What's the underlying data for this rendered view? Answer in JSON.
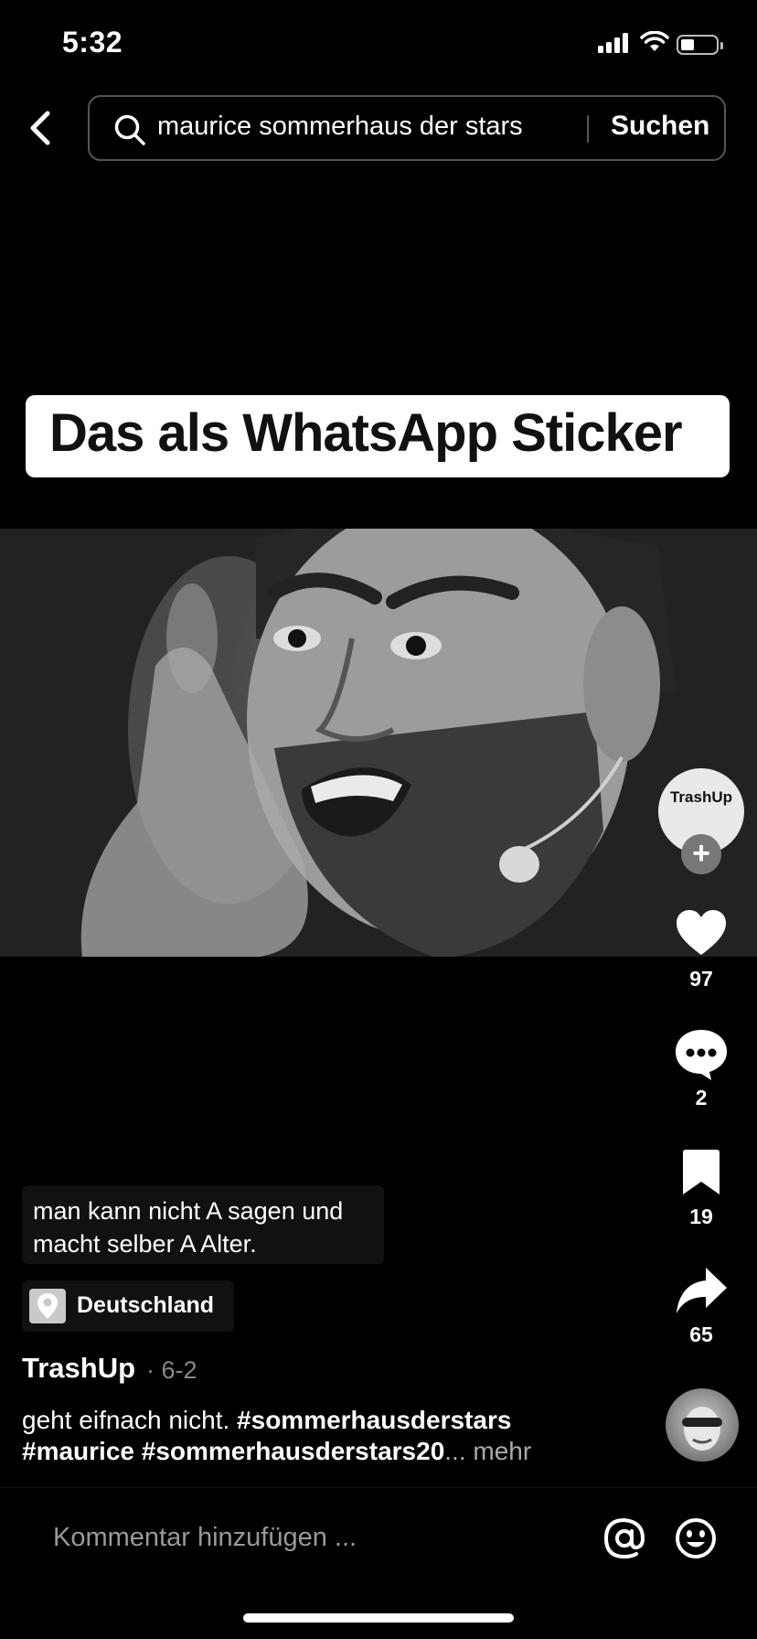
{
  "status_bar": {
    "time": "5:32"
  },
  "search": {
    "query": "maurice sommerhaus der stars",
    "button_label": "Suchen"
  },
  "video": {
    "overlay_text": "Das als WhatsApp Sticker"
  },
  "rail": {
    "avatar_label": "TrashUp",
    "likes": "97",
    "comments": "2",
    "saves": "19",
    "shares": "65"
  },
  "post": {
    "subtitle_text": "man kann nicht A sagen und macht selber A Alter.",
    "location": "Deutschland",
    "username": "TrashUp",
    "date": "· 6-2",
    "caption_plain": "geht eifnach nicht. ",
    "hashtag_1": "#sommerhausderstars",
    "hashtag_2": "#maurice",
    "hashtag_3": "#sommerhausderstars20",
    "more": "... mehr"
  },
  "comment_bar": {
    "placeholder": "Kommentar hinzufügen ..."
  }
}
